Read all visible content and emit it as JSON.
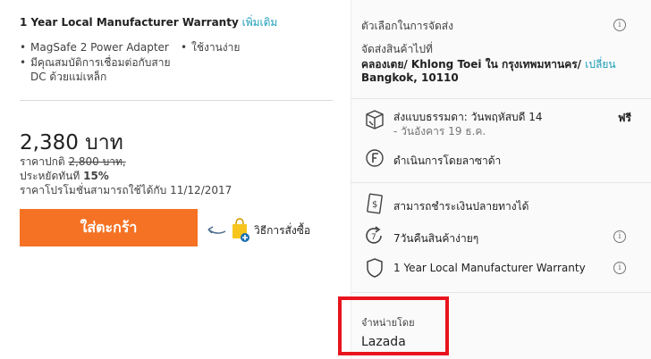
{
  "left": {
    "warranty_title": "1 Year Local Manufacturer Warranty",
    "warranty_more": "เพิ่มเติม",
    "features_col1": [
      "MagSafe 2 Power Adapter",
      "มีคุณสมบัติการเชื่อมต่อกับสาย DC ด้วยแม่เหล็ก"
    ],
    "features_col2": [
      "ใช้งานง่าย"
    ],
    "price": "2,380 บาท",
    "orig_label": "ราคาปกติ",
    "orig_price": "2,800 บาท,",
    "save_label": "ประหยัดทันที",
    "save_value": "15%",
    "promo": "ราคาโปรโมชั่นสามารถใช้ได้กับ 11/12/2017",
    "cart_button": "ใส่ตะกร้า",
    "howto_label": "วิธีการสั่งซื้อ"
  },
  "right": {
    "delivery_title": "ตัวเลือกในการจัดส่ง",
    "ship_to_label": "จัดส่งสินค้าไปที่",
    "address_line1": "คลองเตย/ Khlong Toei ใน กรุงเทพมหานคร/",
    "change_link": "เปลี่ยน",
    "address_line2": "Bangkok, 10110",
    "standard_line1": "ส่งแบบธรรมดา: วันพฤหัสบดี 14",
    "standard_line2": "- วันอังคาร 19 ธ.ค.",
    "free_label": "ฟรี",
    "fulfilled": "ดำเนินการโดยลาซาด้า",
    "cod": "สามารถชำระเงินปลายทางได้",
    "returns": "7วันคืนสินค้าง่ายๆ",
    "warranty": "1 Year Local Manufacturer Warranty",
    "seller_label": "จำหน่ายโดย",
    "seller_name": "Lazada"
  },
  "colors": {
    "accent": "#f57224",
    "link": "#1a9cb7",
    "highlight_box": "#e8141d"
  },
  "icons": [
    "info-icon",
    "truck-icon",
    "lazada-f-icon",
    "cod-icon",
    "return-icon",
    "shield-icon",
    "shopping-bag-icon",
    "arrow-icon"
  ]
}
